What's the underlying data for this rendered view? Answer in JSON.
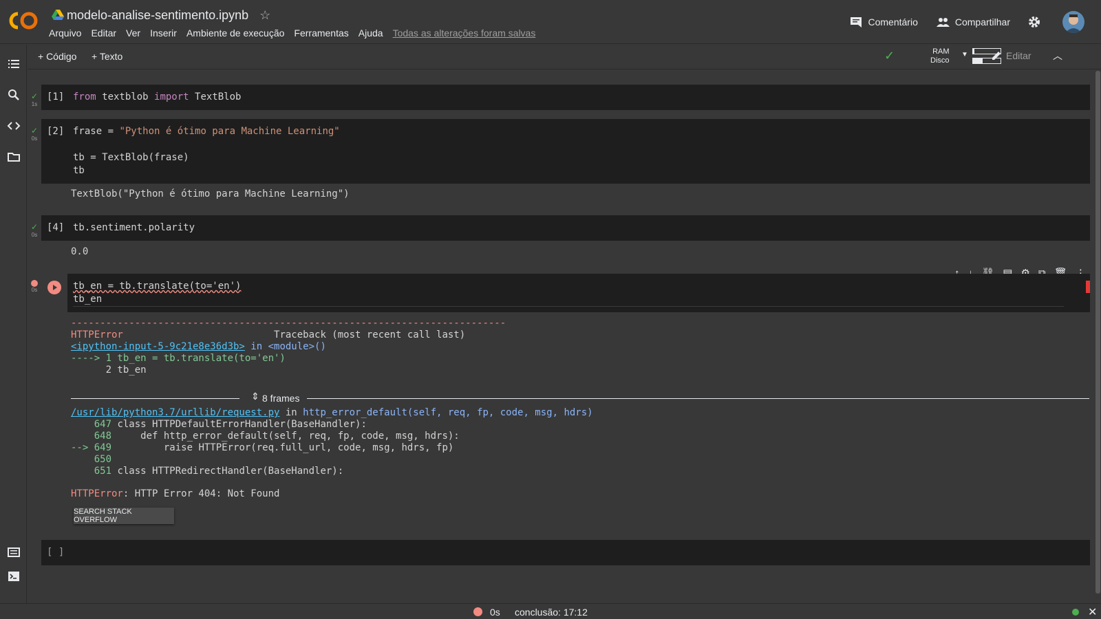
{
  "app": {
    "notebook_title": "modelo-analise-sentimento.ipynb"
  },
  "menu": [
    "Arquivo",
    "Editar",
    "Ver",
    "Inserir",
    "Ambiente de execução",
    "Ferramentas",
    "Ajuda"
  ],
  "saved_status": "Todas as alterações foram salvas",
  "header_actions": {
    "comment": "Comentário",
    "share": "Compartilhar"
  },
  "toolbar": {
    "add_code": "+ Código",
    "add_text": "+ Texto",
    "ram_label": "RAM",
    "disk_label": "Disco",
    "ram_usage": 0.05,
    "disk_usage": 0.35,
    "edit": "Editar"
  },
  "cells": [
    {
      "label": "[1]",
      "time": "1s",
      "code": [
        "from textblob import TextBlob"
      ]
    },
    {
      "label": "[2]",
      "time": "0s",
      "code": [
        "frase = \"Python é ótimo para Machine Learning\"",
        "",
        "tb = TextBlob(frase)",
        "tb"
      ],
      "output": "TextBlob(\"Python é ótimo para Machine Learning\")"
    },
    {
      "label": "[4]",
      "time": "0s",
      "code": [
        "tb.sentiment.polarity"
      ],
      "output": "0.0"
    },
    {
      "label": "",
      "time": "0s",
      "code": [
        "tb_en = tb.translate(to='en')",
        "tb_en"
      ]
    },
    {
      "label": "[ ]",
      "code": []
    }
  ],
  "traceback": {
    "separator": "---------------------------------------------------------------------------",
    "error_type": "HTTPError",
    "header_right": "Traceback (most recent call last)",
    "input_link": "<ipython-input-5-9c21e8e36d3b>",
    "in_module": " in <module>()",
    "arrow_line": "----> 1 tb_en = tb.translate(to='en')",
    "line2": "      2 tb_en",
    "frames": "8 frames",
    "file_link": "/usr/lib/python3.7/urllib/request.py",
    "in_text": " in ",
    "func_sig": "http_error_default(self, req, fp, code, msg, hdrs)",
    "src": [
      {
        "no": "    647",
        "code": " class HTTPDefaultErrorHandler(BaseHandler):"
      },
      {
        "no": "    648",
        "code": "     def http_error_default(self, req, fp, code, msg, hdrs):"
      },
      {
        "no": "--> 649",
        "code": "         raise HTTPError(req.full_url, code, msg, hdrs, fp)"
      },
      {
        "no": "    650",
        "code": ""
      },
      {
        "no": "    651",
        "code": " class HTTPRedirectHandler(BaseHandler):"
      }
    ],
    "final_type": "HTTPError",
    "final_msg": ": HTTP Error 404: Not Found",
    "so_button": "SEARCH STACK OVERFLOW"
  },
  "statusbar": {
    "duration": "0s",
    "completion": "conclusão: 17:12"
  },
  "colors": {
    "accent_error": "#f28b82",
    "success": "#4caf50",
    "link": "#4fc3f7",
    "logo_orange": "#f9ab00"
  }
}
